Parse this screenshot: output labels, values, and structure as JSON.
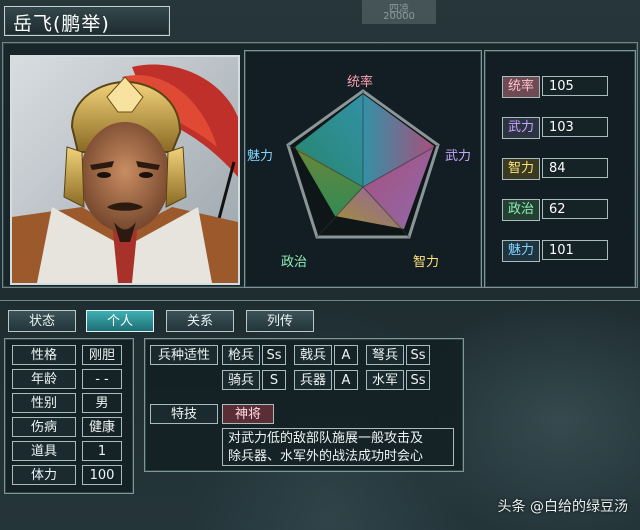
{
  "header": {
    "name": "岳飞(鹏举)",
    "ghost_text_1": "四凉",
    "ghost_text_2": "20000"
  },
  "radar": {
    "labels": {
      "top": "统率",
      "right": "武力",
      "bottom_right": "智力",
      "bottom_left": "政治",
      "left": "魅力"
    }
  },
  "stats": [
    {
      "label": "统率",
      "value": "105"
    },
    {
      "label": "武力",
      "value": "103"
    },
    {
      "label": "智力",
      "value": "84"
    },
    {
      "label": "政治",
      "value": "62"
    },
    {
      "label": "魅力",
      "value": "101"
    }
  ],
  "tabs": [
    {
      "label": "状态",
      "active": false
    },
    {
      "label": "个人",
      "active": true
    },
    {
      "label": "关系",
      "active": false
    },
    {
      "label": "列传",
      "active": false
    }
  ],
  "personal": [
    {
      "label": "性格",
      "value": "刚胆"
    },
    {
      "label": "年龄",
      "value": "- -"
    },
    {
      "label": "性别",
      "value": "男"
    },
    {
      "label": "伤病",
      "value": "健康"
    },
    {
      "label": "道具",
      "value": "1"
    },
    {
      "label": "体力",
      "value": "100"
    }
  ],
  "troops": {
    "title": "兵种适性",
    "items": [
      {
        "label": "枪兵",
        "grade": "Ss"
      },
      {
        "label": "戟兵",
        "grade": "A"
      },
      {
        "label": "弩兵",
        "grade": "Ss"
      },
      {
        "label": "骑兵",
        "grade": "S"
      },
      {
        "label": "兵器",
        "grade": "A"
      },
      {
        "label": "水军",
        "grade": "Ss"
      }
    ]
  },
  "skill": {
    "title": "特技",
    "name": "神将",
    "desc_line1": "对武力低的敌部队施展一般攻击及",
    "desc_line2": "除兵器、水军外的战法成功时会心"
  },
  "watermark": "头条 @白给的绿豆汤",
  "colors": {
    "tab_active": "#1e6e74",
    "skill_name_bg": "#5a2e34",
    "stat_pink": "#ffc1cf",
    "stat_purple": "#c8a6ff",
    "stat_gold": "#ffe37a",
    "stat_green": "#8ff0b6",
    "stat_blue": "#7fd5ff"
  }
}
